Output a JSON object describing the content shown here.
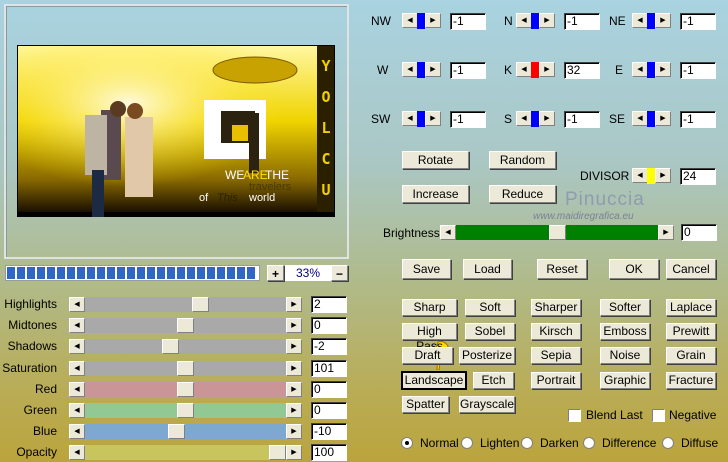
{
  "preview": {
    "text_line1": "WE",
    "text_are": "ARE",
    "text_the": "THE",
    "text_travelers": "travelers",
    "text_of": "of",
    "text_this": "This",
    "text_world": "world",
    "side_letters": "YOLCU"
  },
  "zoom": {
    "plus": "+",
    "value": "33%",
    "minus": "−",
    "progress_segments": 25
  },
  "sliders": [
    {
      "label": "Highlights",
      "value": "2",
      "color": "#a9a9a9",
      "position": 0.58
    },
    {
      "label": "Midtones",
      "value": "0",
      "color": "#a9a9a9",
      "position": 0.5
    },
    {
      "label": "Shadows",
      "value": "-2",
      "color": "#a9a9a9",
      "position": 0.42
    },
    {
      "label": "Saturation",
      "value": "101",
      "color": "#a9a9a9",
      "position": 0.5
    },
    {
      "label": "Red",
      "value": "0",
      "color": "#c99596",
      "position": 0.5
    },
    {
      "label": "Green",
      "value": "0",
      "color": "#92c893",
      "position": 0.5
    },
    {
      "label": "Blue",
      "value": "-10",
      "color": "#7ea9cf",
      "position": 0.45
    },
    {
      "label": "Opacity",
      "value": "100",
      "color": "#c8c55e",
      "position": 1.0
    }
  ],
  "kernel": [
    {
      "label": "NW",
      "value": "-1",
      "color": "#0000ff"
    },
    {
      "label": "N",
      "value": "-1",
      "color": "#0000ff"
    },
    {
      "label": "NE",
      "value": "-1",
      "color": "#0000ff"
    },
    {
      "label": "W",
      "value": "-1",
      "color": "#0000ff"
    },
    {
      "label": "K",
      "value": "32",
      "color": "#ff0000"
    },
    {
      "label": "E",
      "value": "-1",
      "color": "#0000ff"
    },
    {
      "label": "SW",
      "value": "-1",
      "color": "#0000ff"
    },
    {
      "label": "S",
      "value": "-1",
      "color": "#0000ff"
    },
    {
      "label": "SE",
      "value": "-1",
      "color": "#0000ff"
    }
  ],
  "actions": {
    "rotate": "Rotate",
    "random": "Random",
    "increase": "Increase",
    "reduce": "Reduce"
  },
  "divisor": {
    "label": "DIVISOR",
    "value": "24",
    "color": "#ffff00"
  },
  "watermark": {
    "name": "Pinuccia",
    "url": "www.maidiregrafica.eu"
  },
  "brightness": {
    "label": "Brightness",
    "value": "0",
    "color": "#008000",
    "position": 0.5
  },
  "dialog": {
    "save": "Save",
    "load": "Load",
    "reset": "Reset",
    "ok": "OK",
    "cancel": "Cancel"
  },
  "presets": [
    "Sharp",
    "Soft",
    "Sharper",
    "Softer",
    "Laplace",
    "High Pass",
    "Sobel",
    "Kirsch",
    "Emboss",
    "Prewitt",
    "Draft",
    "Posterize",
    "Sepia",
    "Noise",
    "Grain",
    "Landscape",
    "Etch",
    "Portrait",
    "Graphic",
    "Fracture",
    "Spatter",
    "Grayscale"
  ],
  "focused_preset": "Landscape",
  "checkboxes": [
    {
      "label": "Blend Last",
      "checked": false
    },
    {
      "label": "Negative",
      "checked": false
    }
  ],
  "blend_modes": [
    {
      "label": "Normal",
      "selected": true
    },
    {
      "label": "Lighten",
      "selected": false
    },
    {
      "label": "Darken",
      "selected": false
    },
    {
      "label": "Difference",
      "selected": false
    },
    {
      "label": "Diffuse",
      "selected": false
    }
  ]
}
